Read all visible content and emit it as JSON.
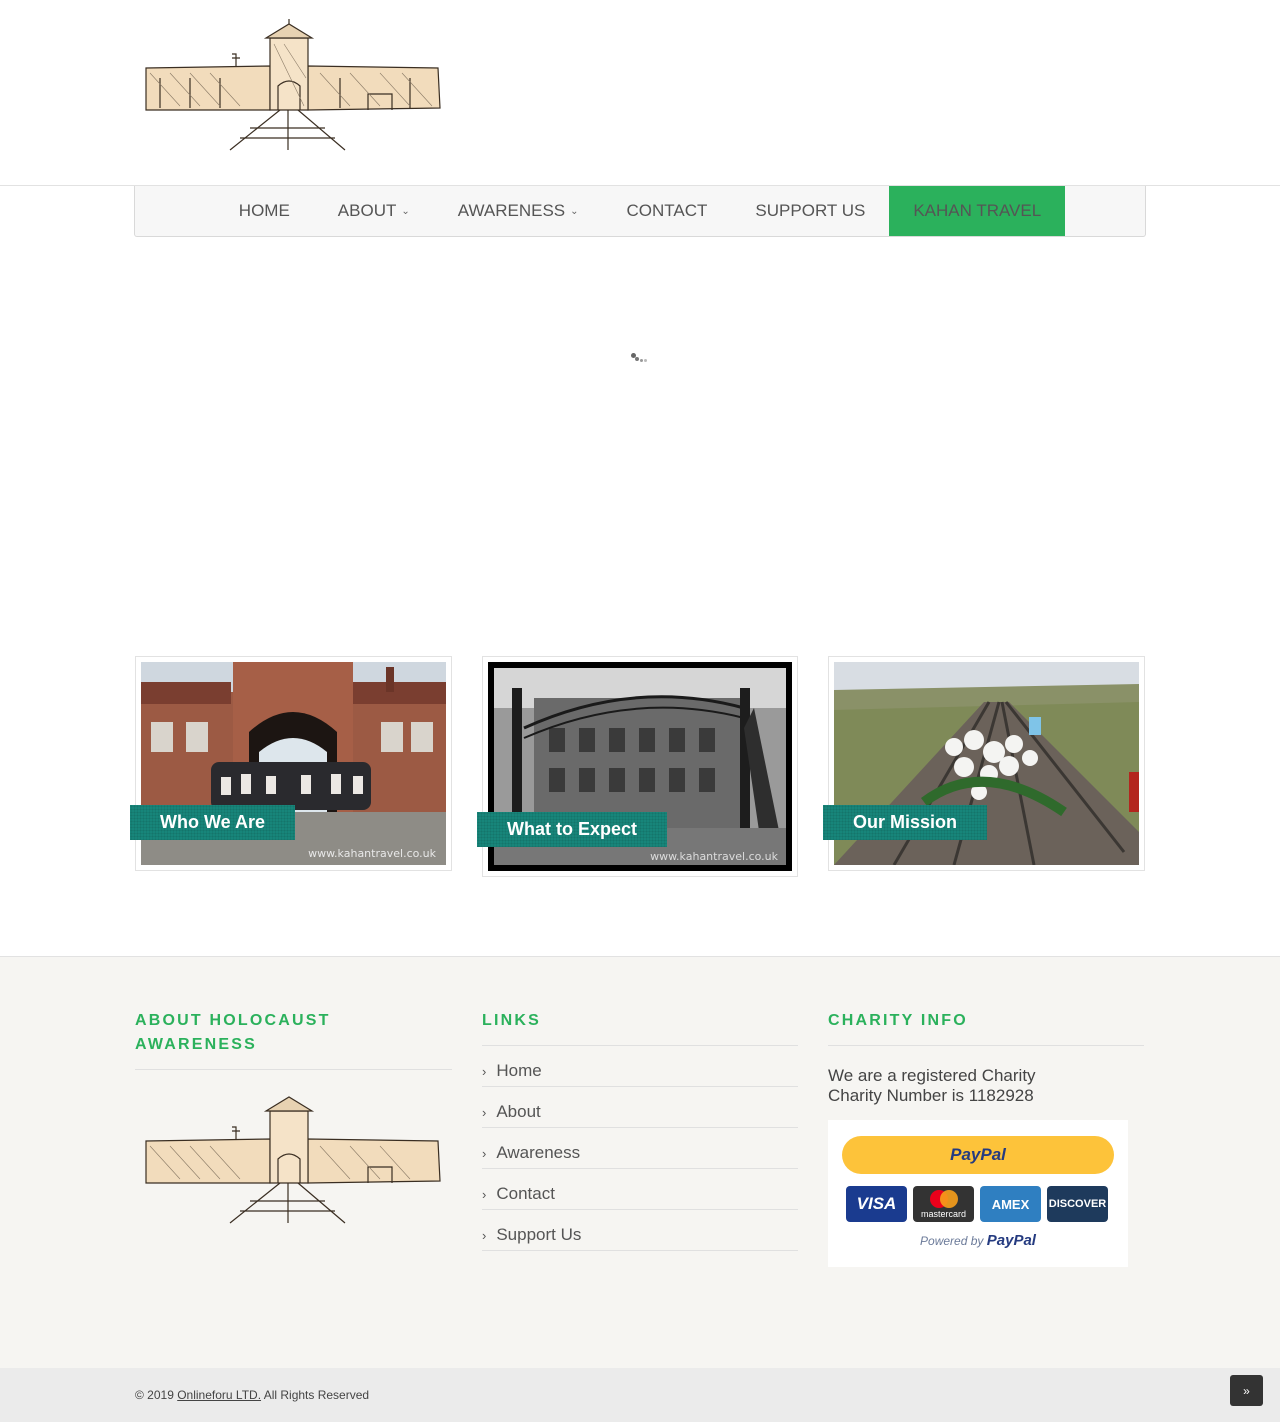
{
  "nav": {
    "items": [
      {
        "label": "HOME",
        "dropdown": false,
        "active": false
      },
      {
        "label": "ABOUT",
        "dropdown": true,
        "active": false
      },
      {
        "label": "AWARENESS",
        "dropdown": true,
        "active": false
      },
      {
        "label": "CONTACT",
        "dropdown": false,
        "active": false
      },
      {
        "label": "SUPPORT US",
        "dropdown": false,
        "active": false
      },
      {
        "label": "KAHAN TRAVEL",
        "dropdown": false,
        "active": true
      }
    ]
  },
  "features": [
    {
      "caption": "Who We Are",
      "watermark": "www.kahantravel.co.uk"
    },
    {
      "caption": "What to Expect",
      "watermark": "www.kahantravel.co.uk"
    },
    {
      "caption": "Our Mission",
      "watermark": ""
    }
  ],
  "footer": {
    "about": {
      "title": "ABOUT HOLOCAUST AWARENESS"
    },
    "links": {
      "title": "LINKS",
      "items": [
        "Home",
        "About",
        "Awareness",
        "Contact",
        "Support Us"
      ]
    },
    "charity": {
      "title": "CHARITY INFO",
      "line1": "We are a registered Charity",
      "line2": "Charity Number is 1182928",
      "paypal_button": "PayPal",
      "cards": [
        "VISA",
        "mastercard",
        "AMEX",
        "DISCOVER"
      ],
      "powered_by": "Powered by",
      "powered_brand": "PayPal"
    }
  },
  "bottom": {
    "copyright_prefix": "© 2019",
    "company": "Onlineforu LTD.",
    "rights": "All Rights Reserved",
    "totop_icon": "double-chevron-up-icon"
  },
  "colors": {
    "accent": "#2bb15c",
    "caption_bg": "#17857a"
  }
}
